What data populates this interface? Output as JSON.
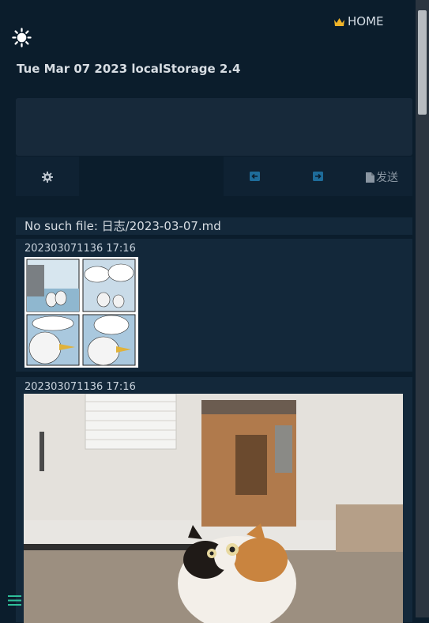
{
  "nav": {
    "home_label": "HOME",
    "home_icon": "crown-icon",
    "theme_icon": "sun-icon"
  },
  "header": {
    "date_text": "Tue Mar 07 2023 localStorage 2.4"
  },
  "toolbar": {
    "settings_icon": "gear-icon",
    "prev_icon": "arrow-left-icon",
    "next_icon": "arrow-right-icon",
    "send_label": "发送",
    "send_icon": "document-icon"
  },
  "notice": {
    "text": "No such file: 日志/2023-03-07.md"
  },
  "entries": [
    {
      "timestamp": "202303071136 17:16",
      "image": "comic-strip-image"
    },
    {
      "timestamp": "202303071136 17:16",
      "image": "cat-photo-image"
    }
  ],
  "footer": {
    "menu_icon": "menu-icon"
  },
  "colors": {
    "background": "#0b1d2c",
    "panel": "#13283a",
    "editor": "#17293a",
    "toolbar": "#0f2233",
    "arrow_accent": "#1e6c9a"
  }
}
